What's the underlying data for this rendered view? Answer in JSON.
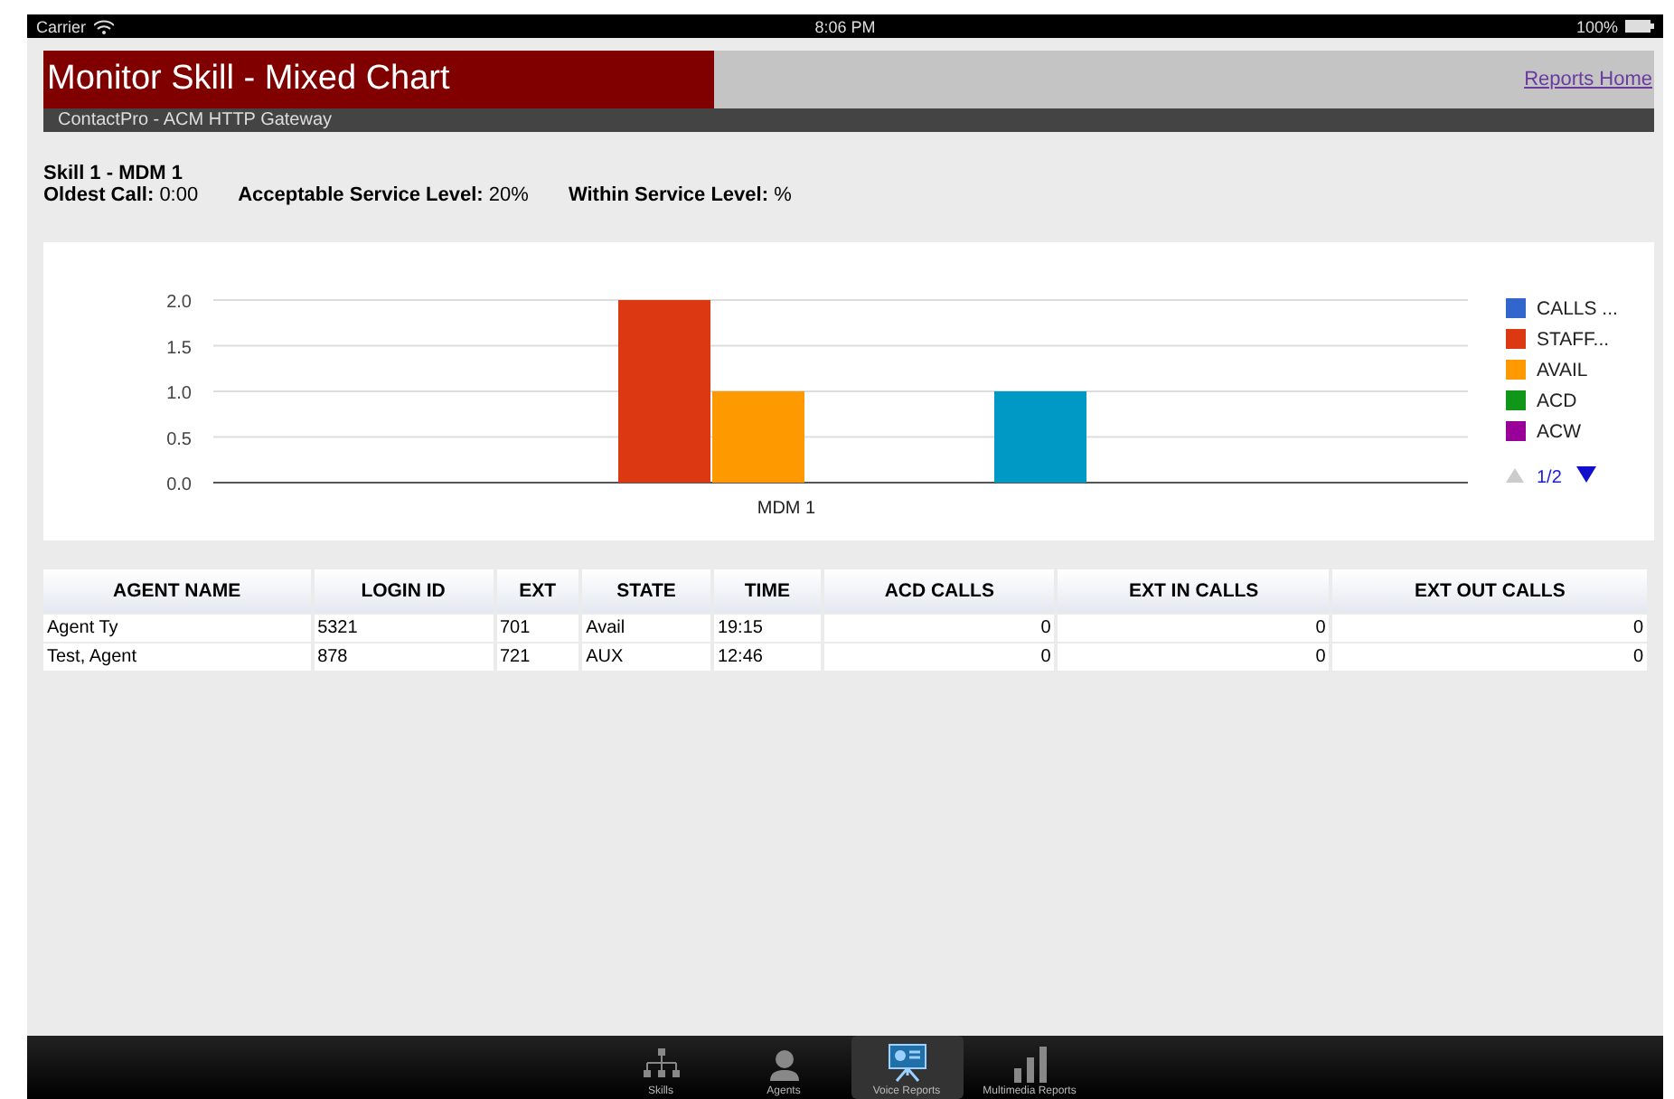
{
  "status_bar": {
    "carrier": "Carrier",
    "time": "8:06 PM",
    "battery": "100%"
  },
  "header": {
    "title": "Monitor Skill - Mixed Chart",
    "subtitle": "ContactPro - ACM HTTP Gateway",
    "link": "Reports Home"
  },
  "skill": {
    "name": "Skill 1 - MDM 1",
    "stats": [
      {
        "label": "Oldest Call:",
        "value": "0:00"
      },
      {
        "label": "Acceptable Service Level:",
        "value": "20%"
      },
      {
        "label": "Within Service Level:",
        "value": "%"
      }
    ]
  },
  "chart": {
    "legend_page": "1/2",
    "chart_data": {
      "type": "bar",
      "grid": true,
      "legend": true,
      "categories": [
        "MDM 1"
      ],
      "ylim": [
        0,
        2
      ],
      "yticks": [
        {
          "value": 0,
          "label": "0.0"
        },
        {
          "value": 0.5,
          "label": "0.5"
        },
        {
          "value": 1,
          "label": "1.0"
        },
        {
          "value": 1.5,
          "label": "1.5"
        },
        {
          "value": 2,
          "label": "2.0"
        }
      ],
      "series": [
        {
          "name": "CALLS ...",
          "color": "#3366cc",
          "values": [
            0
          ]
        },
        {
          "name": "STAFF...",
          "color": "#dc3912",
          "values": [
            2
          ]
        },
        {
          "name": "AVAIL",
          "color": "#ff9900",
          "values": [
            1
          ]
        },
        {
          "name": "ACD",
          "color": "#109618",
          "values": [
            0
          ]
        },
        {
          "name": "ACW",
          "color": "#990099",
          "values": [
            0
          ]
        },
        {
          "color": "#0099c6",
          "values": [
            1
          ]
        }
      ]
    }
  },
  "table": {
    "columns": [
      "AGENT NAME",
      "LOGIN ID",
      "EXT",
      "STATE",
      "TIME",
      "ACD CALLS",
      "EXT IN CALLS",
      "EXT OUT CALLS"
    ],
    "rows": [
      [
        "Agent Ty",
        "5321",
        "701",
        "Avail",
        "19:15",
        "0",
        "0",
        "0"
      ],
      [
        "Test, Agent",
        "878",
        "721",
        "AUX",
        "12:46",
        "0",
        "0",
        "0"
      ]
    ]
  },
  "tab_bar": [
    {
      "label": "Skills",
      "kind": "tree",
      "selected": false
    },
    {
      "label": "Agents",
      "kind": "person",
      "selected": false
    },
    {
      "label": "Voice Reports",
      "kind": "board",
      "selected": true
    },
    {
      "label": "Multimedia Reports",
      "kind": "bars",
      "selected": false
    }
  ]
}
